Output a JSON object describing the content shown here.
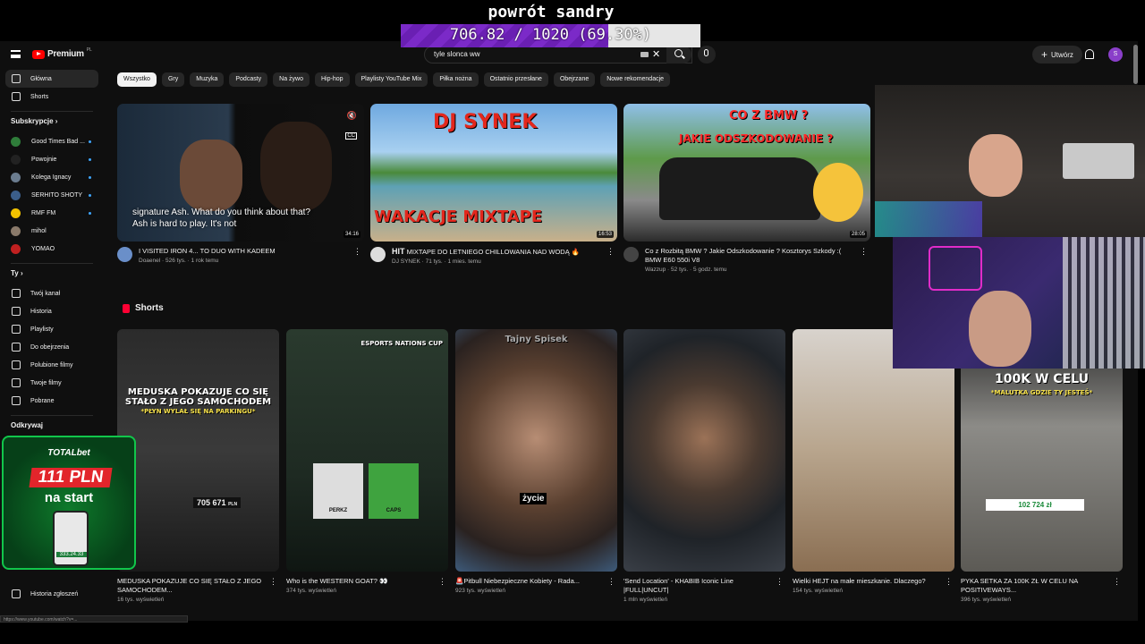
{
  "overlay": {
    "goal_title": "powrót sandry",
    "goal_progress_text": "706.82 / 1020 (69.30%)",
    "goal_fraction": 0.693
  },
  "topbar": {
    "logo_text": "Premium",
    "logo_region": "PL",
    "search_value": "tyle slonca ww",
    "create_label": "Utwórz",
    "avatar_letter": "S"
  },
  "chips": [
    "Wszystko",
    "Gry",
    "Muzyka",
    "Podcasty",
    "Na żywo",
    "Hip-hop",
    "Playlisty YouTube Mix",
    "Piłka nożna",
    "Ostatnio przesłane",
    "Obejrzane",
    "Nowe rekomendacje"
  ],
  "sidebar": {
    "main": [
      {
        "label": "Główna",
        "icon": "home-icon",
        "active": true
      },
      {
        "label": "Shorts",
        "icon": "shorts-icon",
        "active": false
      }
    ],
    "subs_heading": "Subskrypcje",
    "subs": [
      {
        "label": "Good Times Bad ...",
        "color": "#2f7d3a"
      },
      {
        "label": "Powojnie",
        "color": "#222222"
      },
      {
        "label": "Kolega Ignacy",
        "color": "#6b7c8f"
      },
      {
        "label": "SERHITO SHOTY",
        "color": "#3b5e8a"
      },
      {
        "label": "RMF FM",
        "color": "#f2c200"
      },
      {
        "label": "mihol",
        "color": "#8a7a6a"
      },
      {
        "label": "YOMAO",
        "color": "#c02020"
      }
    ],
    "you_heading": "Ty",
    "you": [
      {
        "label": "Twój kanał",
        "icon": "channel-icon"
      },
      {
        "label": "Historia",
        "icon": "history-icon"
      },
      {
        "label": "Playlisty",
        "icon": "playlist-icon"
      },
      {
        "label": "Do obejrzenia",
        "icon": "watch-later-icon"
      },
      {
        "label": "Polubione filmy",
        "icon": "like-icon"
      },
      {
        "label": "Twoje filmy",
        "icon": "your-videos-icon"
      },
      {
        "label": "Pobrane",
        "icon": "download-icon"
      }
    ],
    "explore_heading": "Odkrywaj",
    "report": "Historia zgłoszeń"
  },
  "videos": [
    {
      "title": "I VISITED IRON 4... TO DUO WITH KADEEM",
      "channel": "Doaenel",
      "meta": "526 tys. · 1 rok temu",
      "duration": "34:16",
      "caption": "signature Ash. What do you think about that? Ash is hard to play. It's not",
      "avatar": "#6a8fc9"
    },
    {
      "title": "MIXTAPE DO LETNIEGO CHILLOWANIA NAD WODĄ 🔥",
      "title_prefix": "HIT",
      "channel": "DJ SYNEK",
      "meta": "71 tys. · 1 mies. temu",
      "duration": "16:53",
      "overlay_top": "DJ SYNEK",
      "overlay_bottom": "WAKACJE MIXTAPE",
      "avatar": "#dddddd"
    },
    {
      "title": "Co z Rozbitą BMW ? Jakie Odszkodowanie ? Kosztorys Szkody :( BMW E60 550i V8",
      "channel": "Wazzup",
      "meta": "52 tys. · 5 godz. temu",
      "duration": "28:05",
      "overlay_top": "CO Z BMW ?",
      "overlay_sub": "JAKIE ODSZKODOWANIE ?",
      "avatar": "#444444"
    }
  ],
  "shorts_heading": "Shorts",
  "shorts": [
    {
      "title": "MEDUSKA POKAZUJE CO SIĘ STAŁO Z JEGO SAMOCHODEM...",
      "views": "16 tys. wyświetleń",
      "label_top": "MEDUSKA POKAZUJE CO SIĘ STAŁO Z JEGO SAMOCHODEM",
      "label_sub": "*PŁYN WYLAŁ SIĘ NA PARKINGU*",
      "badge": "705 671",
      "badge_unit": "PLN"
    },
    {
      "title": "Who is the WESTERN GOAT? 👀",
      "views": "374 tys. wyświetleń",
      "label_top": "ESPORTS NATIONS CUP",
      "tag_left": "PERKZ",
      "tag_right": "CAPS"
    },
    {
      "title": "🚨Pitbull Niebezpieczne Kobiety - Rada...",
      "views": "923 tys. wyświetleń",
      "label_top": "Tajny Spisek",
      "caption": "życie"
    },
    {
      "title": "'Send Location' - KHABIB Iconic Line |FULL|UNCUT|",
      "views": "1 mln wyświetleń"
    },
    {
      "title": "Wielki HEJT na małe mieszkanie. Dlaczego?",
      "views": "154 tys. wyświetleń"
    },
    {
      "title": "PYKA SETKA ZA 100K ZŁ W CELU NA POSITIVEWAYS...",
      "views": "396 tys. wyświetleń",
      "label_top": "100K W CELU",
      "label_sub": "*MALUTKA GDZIE TY JESTEŚ*",
      "badge": "102 724 zł"
    }
  ],
  "promo": {
    "brand": "TOTALbet",
    "amount": "111 PLN",
    "sub": "na start",
    "phone_amount": "333.24.33"
  },
  "status_url": "https://www.youtube.com/watch?v=..."
}
